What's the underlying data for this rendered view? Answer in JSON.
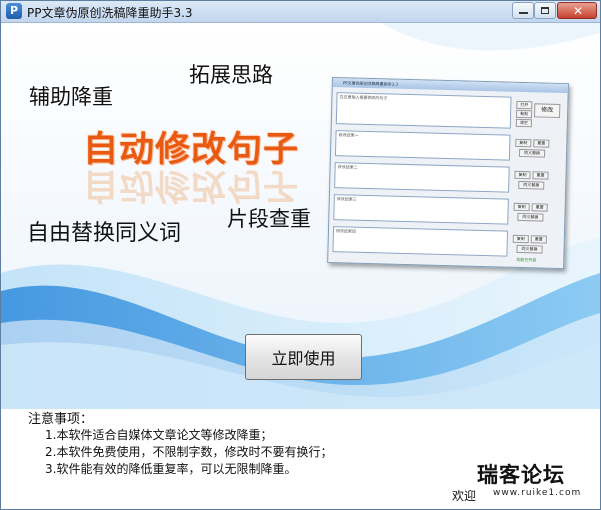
{
  "window": {
    "title": "PP文章伪原创洗稿降重助手3.3",
    "logo_letter": "P"
  },
  "hero": {
    "feature_assist": "辅助降重",
    "feature_ideas": "拓展思路",
    "feature_auto": "自动修改句子",
    "feature_synonym": "自由替换同义词",
    "feature_segment": "片段查重"
  },
  "preview": {
    "input_hint": "在这里输入需要修改的句子",
    "slots": [
      "修改结果一",
      "修改结果二",
      "修改结果三",
      "修改结果四"
    ],
    "btn_copy": "复制",
    "btn_reset": "重置",
    "btn_synonym": "同义替换",
    "btn_modify": "修改",
    "btn_open": "打开",
    "btn_paste": "粘贴",
    "btn_clear": "清空",
    "status": "功能已开启"
  },
  "actions": {
    "use_now": "立即使用"
  },
  "notes": {
    "title": "注意事项：",
    "items": [
      "1.本软件适合自媒体文章论文等修改降重；",
      "2.本软件免费使用，不限制字数，修改时不要有换行；",
      "3.软件能有效的降低重复率，可以无限制降重。"
    ]
  },
  "footer": {
    "welcome": "欢迎",
    "watermark": "瑞客论坛",
    "watermark_url": "www.ruike1.com"
  },
  "colors": {
    "accent_orange": "#e85a12",
    "sky": "#4aa3e6",
    "titlebar": "#c2d6ee"
  }
}
